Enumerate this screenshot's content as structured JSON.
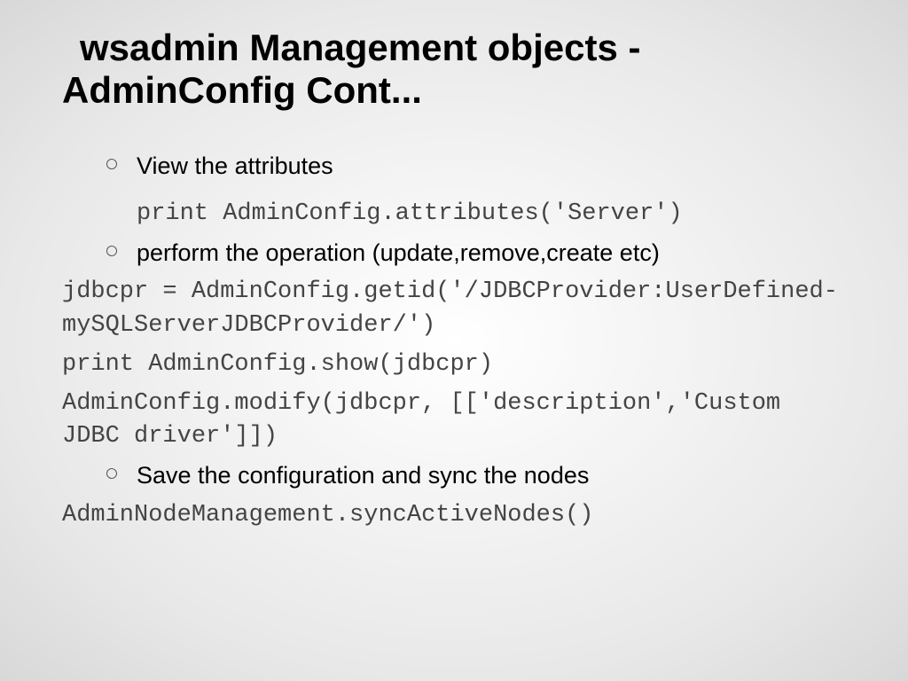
{
  "title": "wsadmin Management objects - AdminConfig Cont...",
  "items": [
    {
      "bullet": "View the attributes",
      "code": "print AdminConfig.attributes('Server')"
    },
    {
      "bullet": "perform the operation (update,remove,create etc)",
      "codes": [
        "jdbcpr = AdminConfig.getid('/JDBCProvider:UserDefined-mySQLServerJDBCProvider/')",
        "print AdminConfig.show(jdbcpr)",
        "AdminConfig.modify(jdbcpr, [['description','Custom JDBC driver']])"
      ]
    },
    {
      "bullet": "Save the configuration and sync the nodes",
      "codes": [
        "AdminNodeManagement.syncActiveNodes()"
      ]
    }
  ]
}
